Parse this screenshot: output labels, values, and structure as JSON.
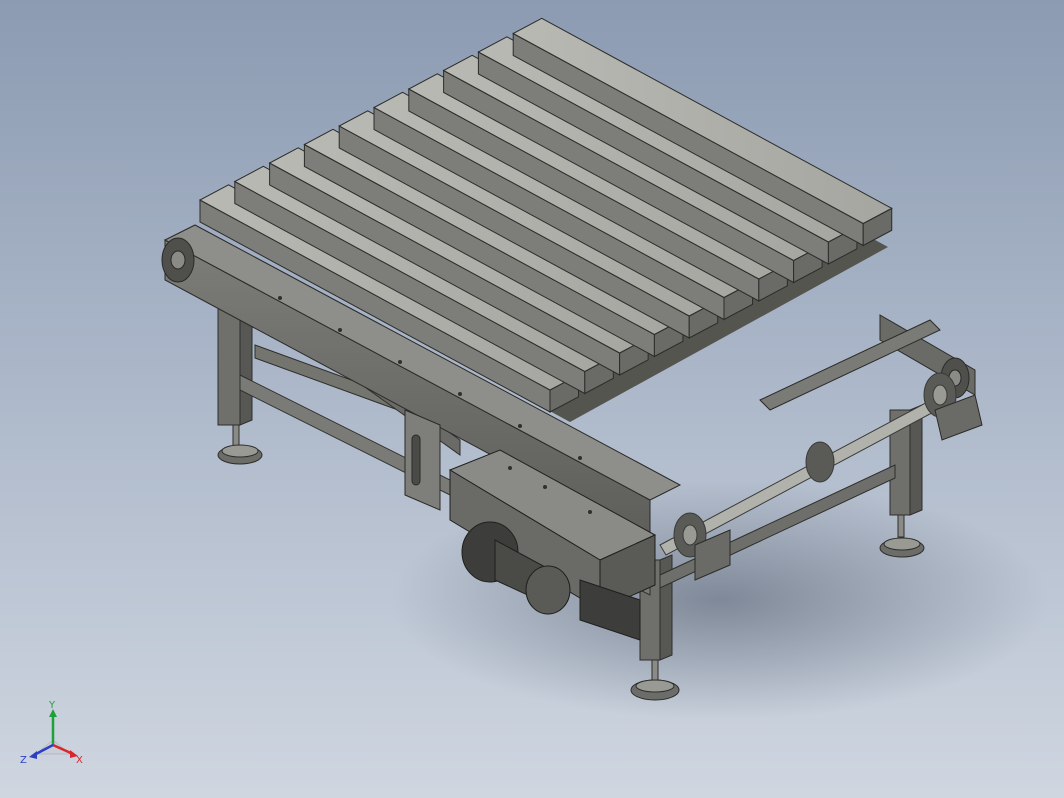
{
  "viewport": {
    "background_top": "#8c9bb2",
    "background_bottom": "#cfd6e0",
    "model": "pallet-chain-conveyor",
    "pallet_board_count": 10
  },
  "triad": {
    "x_label": "X",
    "y_label": "Y",
    "z_label": "Z",
    "x_color": "#d8262b",
    "y_color": "#1fa038",
    "z_color": "#2b3fc4"
  }
}
